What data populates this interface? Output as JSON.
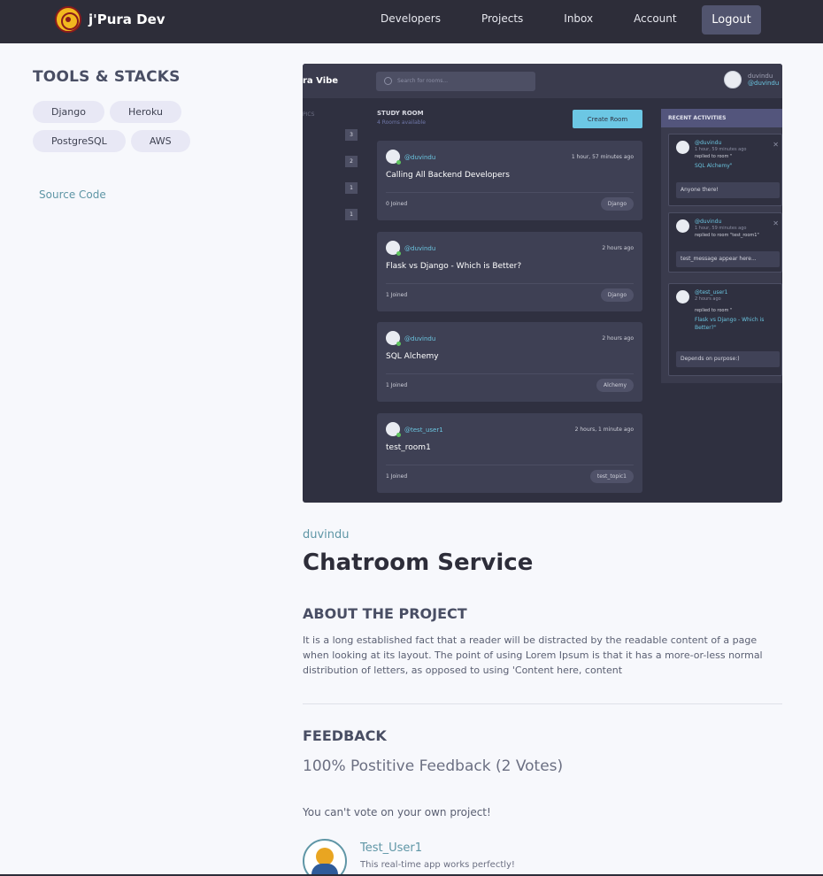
{
  "header": {
    "brand": "j'Pura Dev",
    "nav": [
      "Developers",
      "Projects",
      "Inbox",
      "Account"
    ],
    "logout": "Logout"
  },
  "sidebar": {
    "title": "TOOLS & STACKS",
    "tags": [
      "Django",
      "Heroku",
      "PostgreSQL",
      "AWS"
    ],
    "source": "Source Code"
  },
  "screenshot": {
    "brand": "ra Vibe",
    "search_placeholder": "Search for rooms...",
    "user_name": "duvindu",
    "user_handle": "@duvindu",
    "topics_label": "PICS",
    "topic_counts": [
      "3",
      "2",
      "1",
      "1"
    ],
    "study_title": "STUDY ROOM",
    "study_sub": "4 Rooms available",
    "create": "Create Room",
    "rooms": [
      {
        "host": "@duvindu",
        "time": "1 hour, 57 minutes ago",
        "title": "Calling All Backend Developers",
        "joined": "0 Joined",
        "topic": "Django"
      },
      {
        "host": "@duvindu",
        "time": "2 hours ago",
        "title": "Flask vs Django - Which is Better?",
        "joined": "1 Joined",
        "topic": "Django"
      },
      {
        "host": "@duvindu",
        "time": "2 hours ago",
        "title": "SQL Alchemy",
        "joined": "1 Joined",
        "topic": "Alchemy"
      },
      {
        "host": "@test_user1",
        "time": "2 hours, 1 minute ago",
        "title": "test_room1",
        "joined": "1 Joined",
        "topic": "test_topic1"
      }
    ],
    "recent_title": "RECENT ACTIVITIES",
    "activities": [
      {
        "who": "@duvindu",
        "when": "1 hour, 59 minutes ago",
        "what": "replied to room \"",
        "room": "SQL Alchemy\"",
        "msg": "Anyone there!"
      },
      {
        "who": "@duvindu",
        "when": "1 hour, 59 minutes ago",
        "what": "replied to room \"test_room1\"",
        "room": "",
        "msg": "test_message appear here..."
      },
      {
        "who": "@test_user1",
        "when": "2 hours ago",
        "what": "replied to room \"",
        "room": "Flask vs Django - Which is Better?\"",
        "msg": "Depends on purpose:)"
      }
    ]
  },
  "project": {
    "owner": "duvindu",
    "title": "Chatroom Service",
    "about_heading": "ABOUT THE PROJECT",
    "about_text": "It is a long established fact that a reader will be distracted by the readable content of a page when looking at its layout. The point of using Lorem Ipsum is that it has a more-or-less normal distribution of letters, as opposed to using 'Content here, content",
    "feedback_heading": "FEEDBACK",
    "feedback_stat": "100% Postitive Feedback (2 Votes)",
    "vote_note": "You can't vote on your own project!",
    "review": {
      "name": "Test_User1",
      "text": "This real-time app works perfectly!"
    }
  }
}
